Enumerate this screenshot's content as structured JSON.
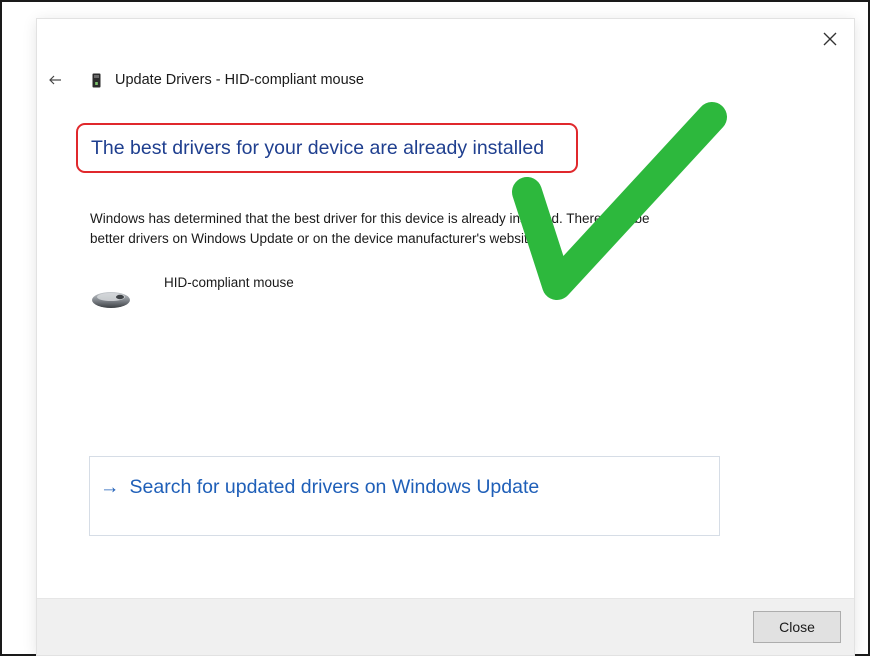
{
  "window": {
    "title": "Update Drivers - HID-compliant mouse"
  },
  "content": {
    "heading": "The best drivers for your device are already installed",
    "description_line1": "Windows has determined that the best driver for this device is already installed. There may be",
    "description_line2": "better drivers on Windows Update or on the device manufacturer's website.",
    "device_name": "HID-compliant mouse",
    "search_link_arrow": "→",
    "search_link_label": "Search for updated drivers on Windows Update"
  },
  "footer": {
    "close_label": "Close"
  },
  "icons": {
    "back": "back-arrow-icon",
    "title": "device-icon",
    "close": "close-icon",
    "device": "mouse-icon",
    "overlay": "checkmark-icon"
  },
  "colors": {
    "heading": "#1f3f8f",
    "link": "#1f5fb8",
    "highlight_box": "#e0282c",
    "checkmark": "#2db83d"
  }
}
